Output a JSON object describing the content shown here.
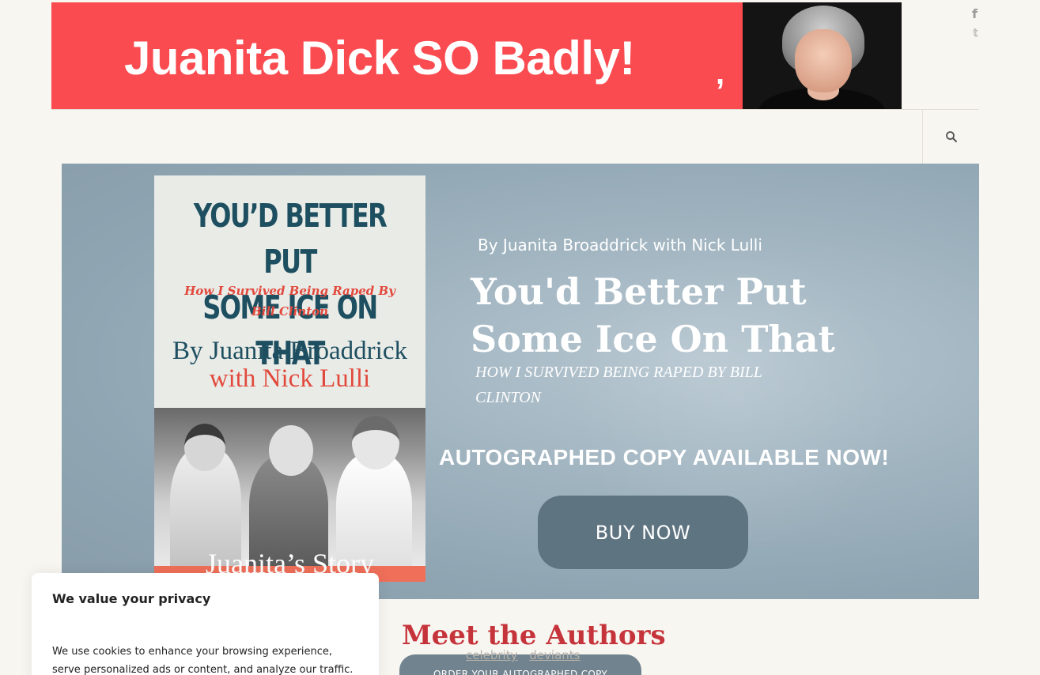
{
  "banner": {
    "headline": "Juanita Dick SO Badly!",
    "comma": ",",
    "colors": {
      "background": "#fa4b50",
      "text": "#ffffff"
    }
  },
  "social": {
    "facebook_icon": "f",
    "twitter_icon": "𝕥"
  },
  "hero": {
    "book_cover": {
      "title_line1": "YOU’D BETTER PUT",
      "title_line2": "SOME ICE ON THAT",
      "subtitle_line1": "How I Survived Being Raped By",
      "subtitle_line2": "Bill Clinton",
      "author_line1": "By Juanita Broaddrick",
      "author_line2": "with Nick Lulli",
      "footer": "Juanita’s Story"
    },
    "author_line": "By Juanita Broaddrick with Nick Lulli",
    "title_line1": "You'd Better Put",
    "title_line2": "Some Ice On That",
    "subtitle": "HOW I SURVIVED BEING RAPED BY BILL CLINTON",
    "autograph_notice": "AUTOGRAPHED COPY AVAILABLE NOW!",
    "buy_button": "BUY NOW",
    "colors": {
      "button": "#5f7481",
      "background": "#9fb3bf"
    }
  },
  "section": {
    "heading": "Meet the Authors",
    "tags": [
      "celebrity",
      "deviants"
    ],
    "order_button": "ORDER YOUR AUTOGRAPHED COPY"
  },
  "cookie_banner": {
    "title": "We value your privacy",
    "body": "We use cookies to enhance your browsing experience, serve personalized ads or content, and analyze our traffic. By"
  }
}
